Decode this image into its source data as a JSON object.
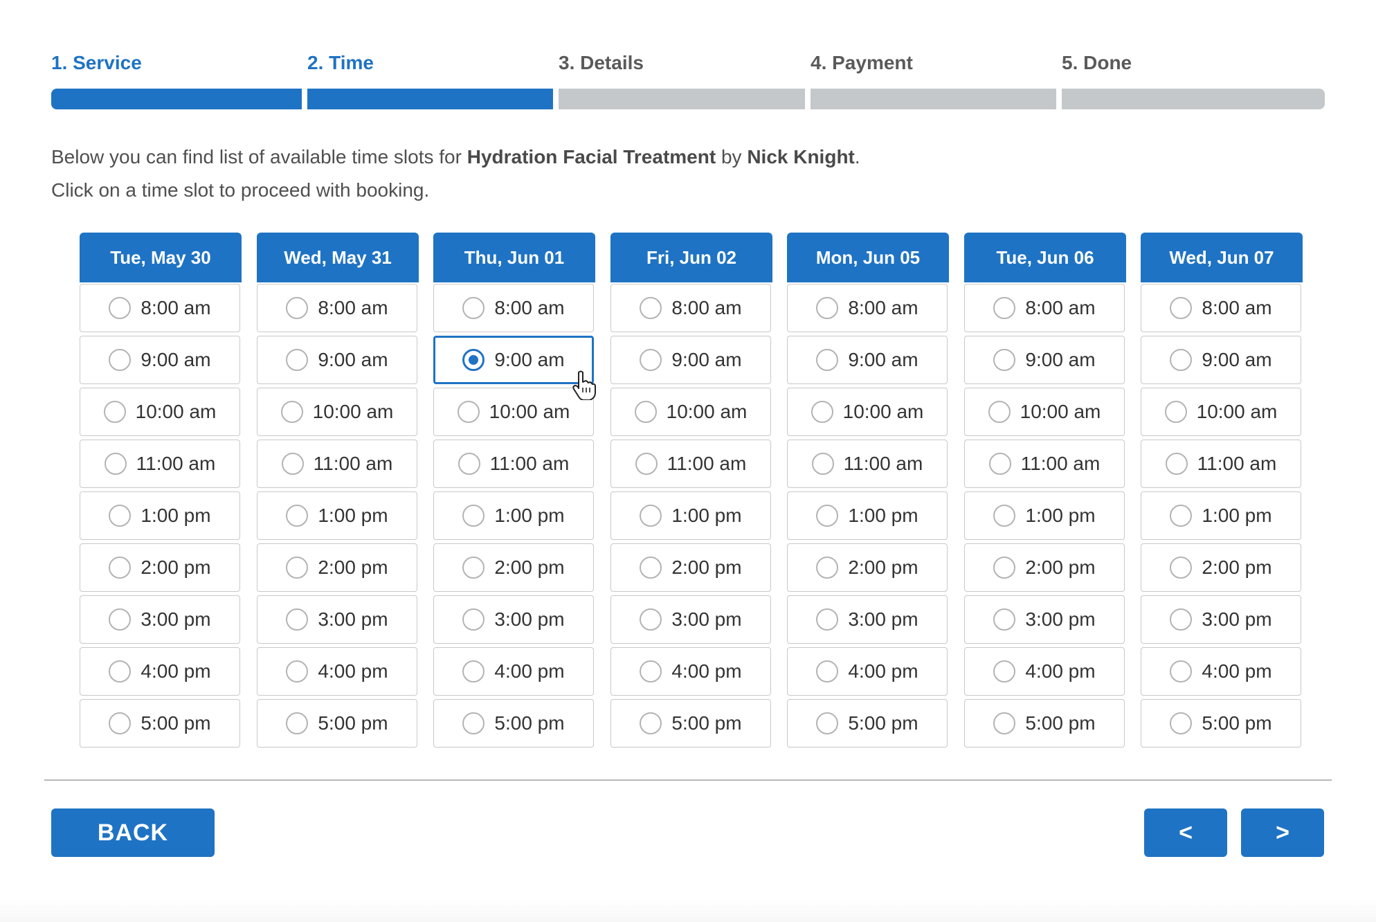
{
  "steps": [
    {
      "label": "1. Service",
      "active": true
    },
    {
      "label": "2. Time",
      "active": true
    },
    {
      "label": "3. Details",
      "active": false
    },
    {
      "label": "4. Payment",
      "active": false
    },
    {
      "label": "5. Done",
      "active": false
    }
  ],
  "intro": {
    "line1_pre": "Below you can find list of available time slots for ",
    "service": "Hydration Facial Treatment",
    "by": " by ",
    "staff": "Nick Knight",
    "period": ".",
    "line2": "Click on a time slot to proceed with booking."
  },
  "days": [
    {
      "label": "Tue, May 30"
    },
    {
      "label": "Wed, May 31"
    },
    {
      "label": "Thu, Jun 01"
    },
    {
      "label": "Fri, Jun 02"
    },
    {
      "label": "Mon, Jun 05"
    },
    {
      "label": "Tue, Jun 06"
    },
    {
      "label": "Wed, Jun 07"
    }
  ],
  "times": [
    "8:00 am",
    "9:00 am",
    "10:00 am",
    "11:00 am",
    "1:00 pm",
    "2:00 pm",
    "3:00 pm",
    "4:00 pm",
    "5:00 pm"
  ],
  "selected": {
    "day": "Thu, Jun 01",
    "time": "9:00 am"
  },
  "buttons": {
    "back": "BACK",
    "prev": "<",
    "next": ">"
  },
  "colors": {
    "accent": "#1f73c4",
    "inactive_bar": "#c4c8ca"
  }
}
